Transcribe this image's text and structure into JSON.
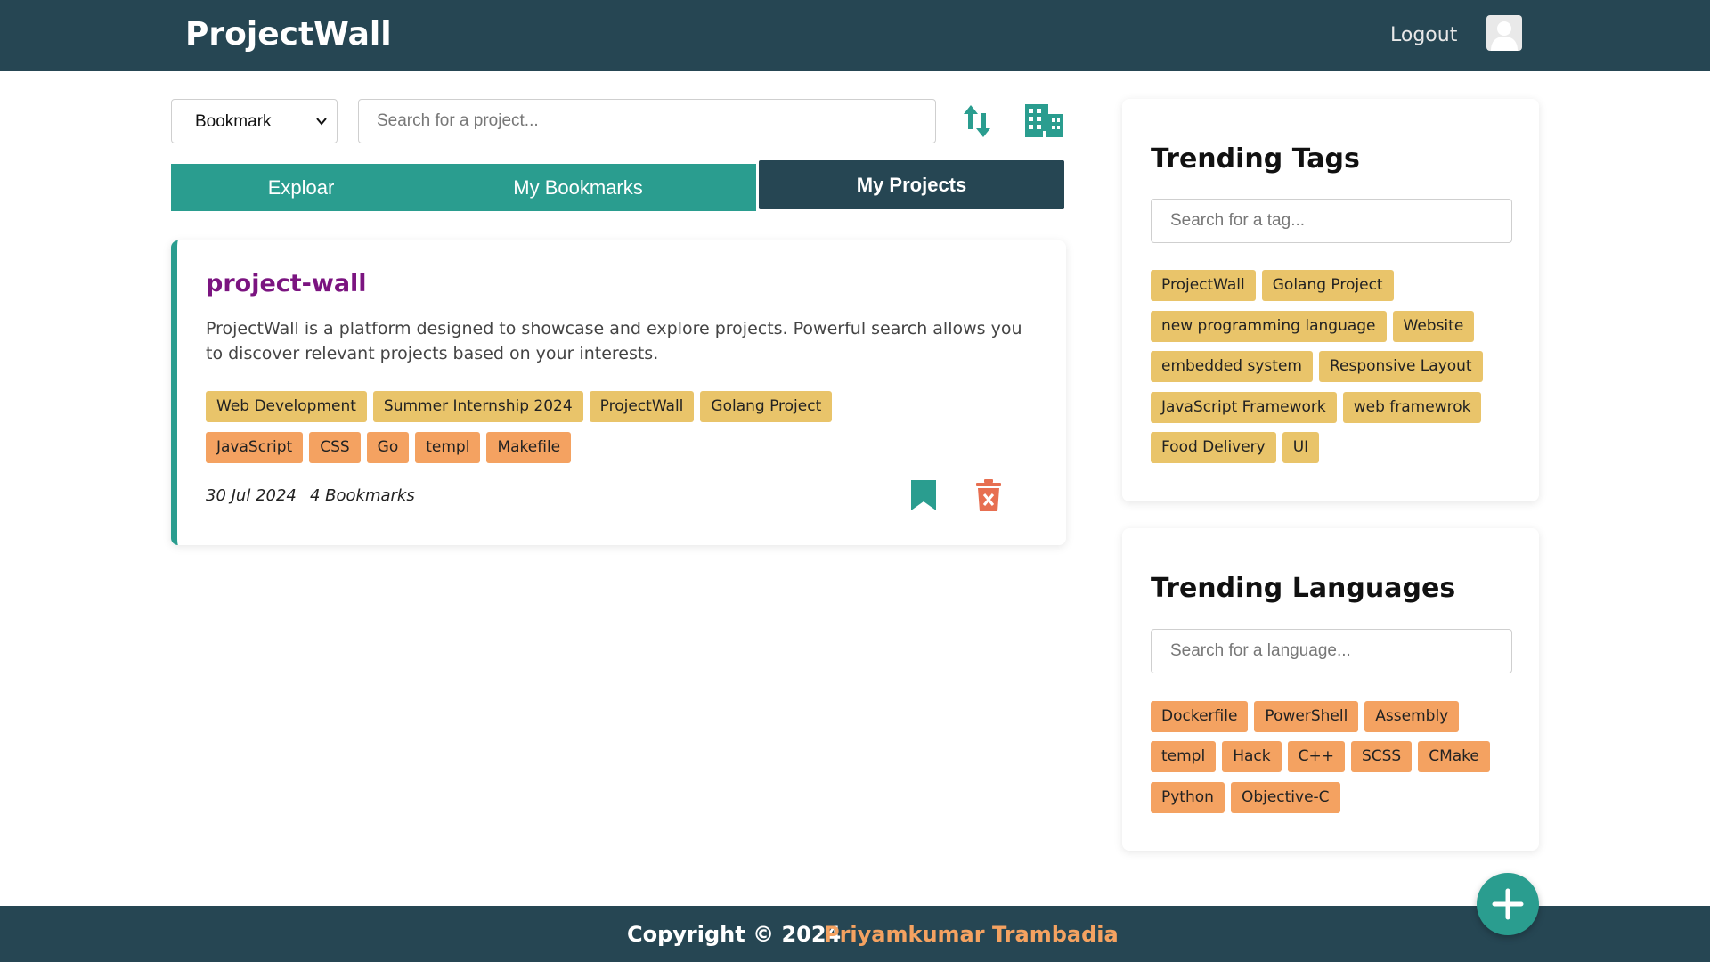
{
  "header": {
    "brand": "ProjectWall",
    "logout_label": "Logout",
    "avatar_icon": "user-avatar-icon"
  },
  "toolbar": {
    "filter_selected": "Bookmark",
    "search_placeholder": "Search for a project...",
    "sort_icon": "sort-arrows-icon",
    "grid_icon": "building-grid-icon"
  },
  "tabs": {
    "explore": "Exploar",
    "bookmarks": "My Bookmarks",
    "projects": "My Projects",
    "active": "My Projects"
  },
  "project": {
    "title": "project-wall",
    "description": "ProjectWall is a platform designed to showcase and explore projects. Powerful search allows you to discover relevant projects based on your interests.",
    "tags": [
      "Web Development",
      "Summer Internship 2024",
      "ProjectWall",
      "Golang Project"
    ],
    "languages": [
      "JavaScript",
      "CSS",
      "Go",
      "templ",
      "Makefile"
    ],
    "date": "30 Jul 2024",
    "bookmarks": "4 Bookmarks"
  },
  "trending_tags": {
    "title": "Trending Tags",
    "search_placeholder": "Search for a tag...",
    "rows": [
      [
        "ProjectWall",
        "Golang Project"
      ],
      [
        "new programming language",
        "Website"
      ],
      [
        "embedded system",
        "Responsive Layout"
      ],
      [
        "JavaScript Framework",
        "web framewrok"
      ],
      [
        "Food Delivery",
        "UI"
      ]
    ]
  },
  "trending_languages": {
    "title": "Trending Languages",
    "search_placeholder": "Search for a language...",
    "rows": [
      [
        "Dockerfile",
        "PowerShell",
        "Assembly"
      ],
      [
        "templ",
        "Hack",
        "C++",
        "SCSS",
        "CMake"
      ],
      [
        "Python",
        "Objective-C"
      ]
    ]
  },
  "footer": {
    "copyright": "Copyright © 2024",
    "author": "Priyamkumar Trambadia"
  },
  "colors": {
    "navy": "#264653",
    "teal": "#2a9d8f",
    "tag_yellow": "#e9c46a",
    "tag_orange": "#f4a261",
    "delete_red": "#e76f51",
    "title_purple": "#7b1480"
  }
}
